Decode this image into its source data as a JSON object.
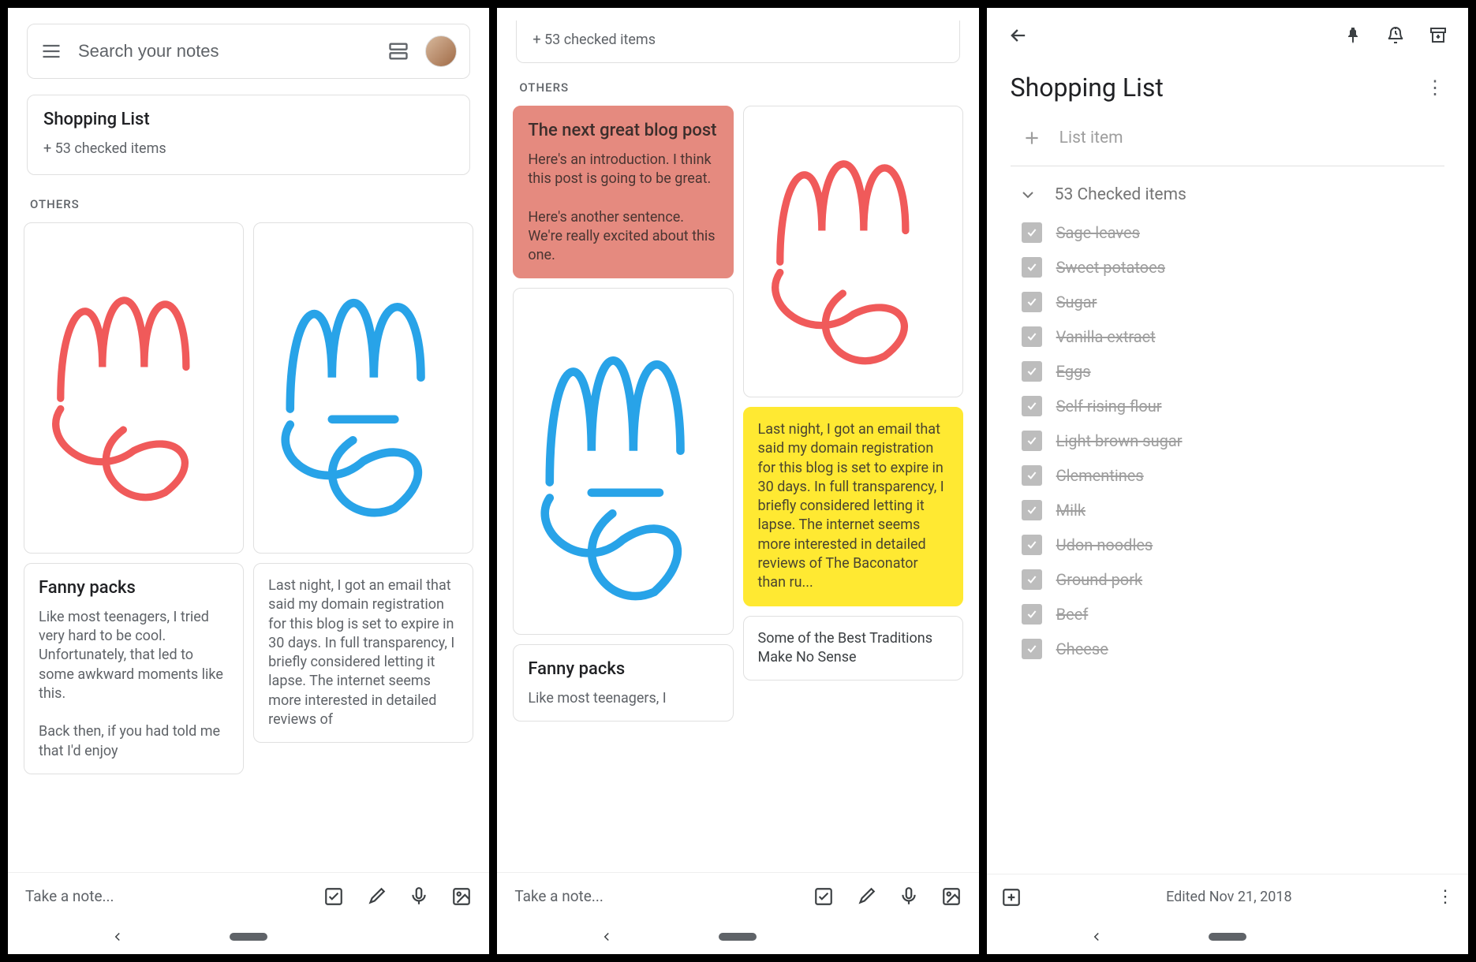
{
  "panel1": {
    "search_placeholder": "Search your notes",
    "pinned": {
      "title": "Shopping List",
      "sub": "+ 53 checked items"
    },
    "section_label": "OTHERS",
    "note_fanny": {
      "title": "Fanny packs",
      "body1": "Like most teenagers, I tried very hard to be cool. Unfortunately, that led to some awkward moments like this.",
      "body2": "Back then, if you had told me that I'd enjoy"
    },
    "note_domain": {
      "body": "Last night, I got an email that said my domain registration for this blog is set to expire in 30 days. In full transparency, I briefly considered letting it lapse. The internet seems more interested in detailed reviews of"
    },
    "take_note": "Take a note..."
  },
  "panel2": {
    "pinned_sub": "+ 53 checked items",
    "section_label": "OTHERS",
    "note_blog": {
      "title": "The next great blog post",
      "body1": "Here's an introduction. I think this post is going to be great.",
      "body2": "Here's another sentence. We're really excited about this one."
    },
    "note_domain_yellow": {
      "body": "Last night, I got an email that said my domain registration for this blog is set to expire in 30 days. In full transparency, I briefly considered letting it lapse. The internet seems more interested in detailed reviews of The Baconator than ru..."
    },
    "note_fanny": {
      "title": "Fanny packs",
      "body": "Like most teenagers, I"
    },
    "note_traditions": {
      "body": "Some of the Best Traditions Make No Sense"
    },
    "take_note": "Take a note..."
  },
  "panel3": {
    "title": "Shopping List",
    "add_item_placeholder": "List item",
    "checked_header": "53 Checked items",
    "items": [
      "Sage leaves",
      "Sweet potatoes",
      "Sugar",
      "Vanilla extract",
      "Eggs",
      "Self rising flour",
      "Light brown sugar",
      "Clementines",
      "Milk",
      "Udon noodles",
      "Ground pork",
      "Beef",
      "Cheese"
    ],
    "edited": "Edited Nov 21, 2018"
  }
}
